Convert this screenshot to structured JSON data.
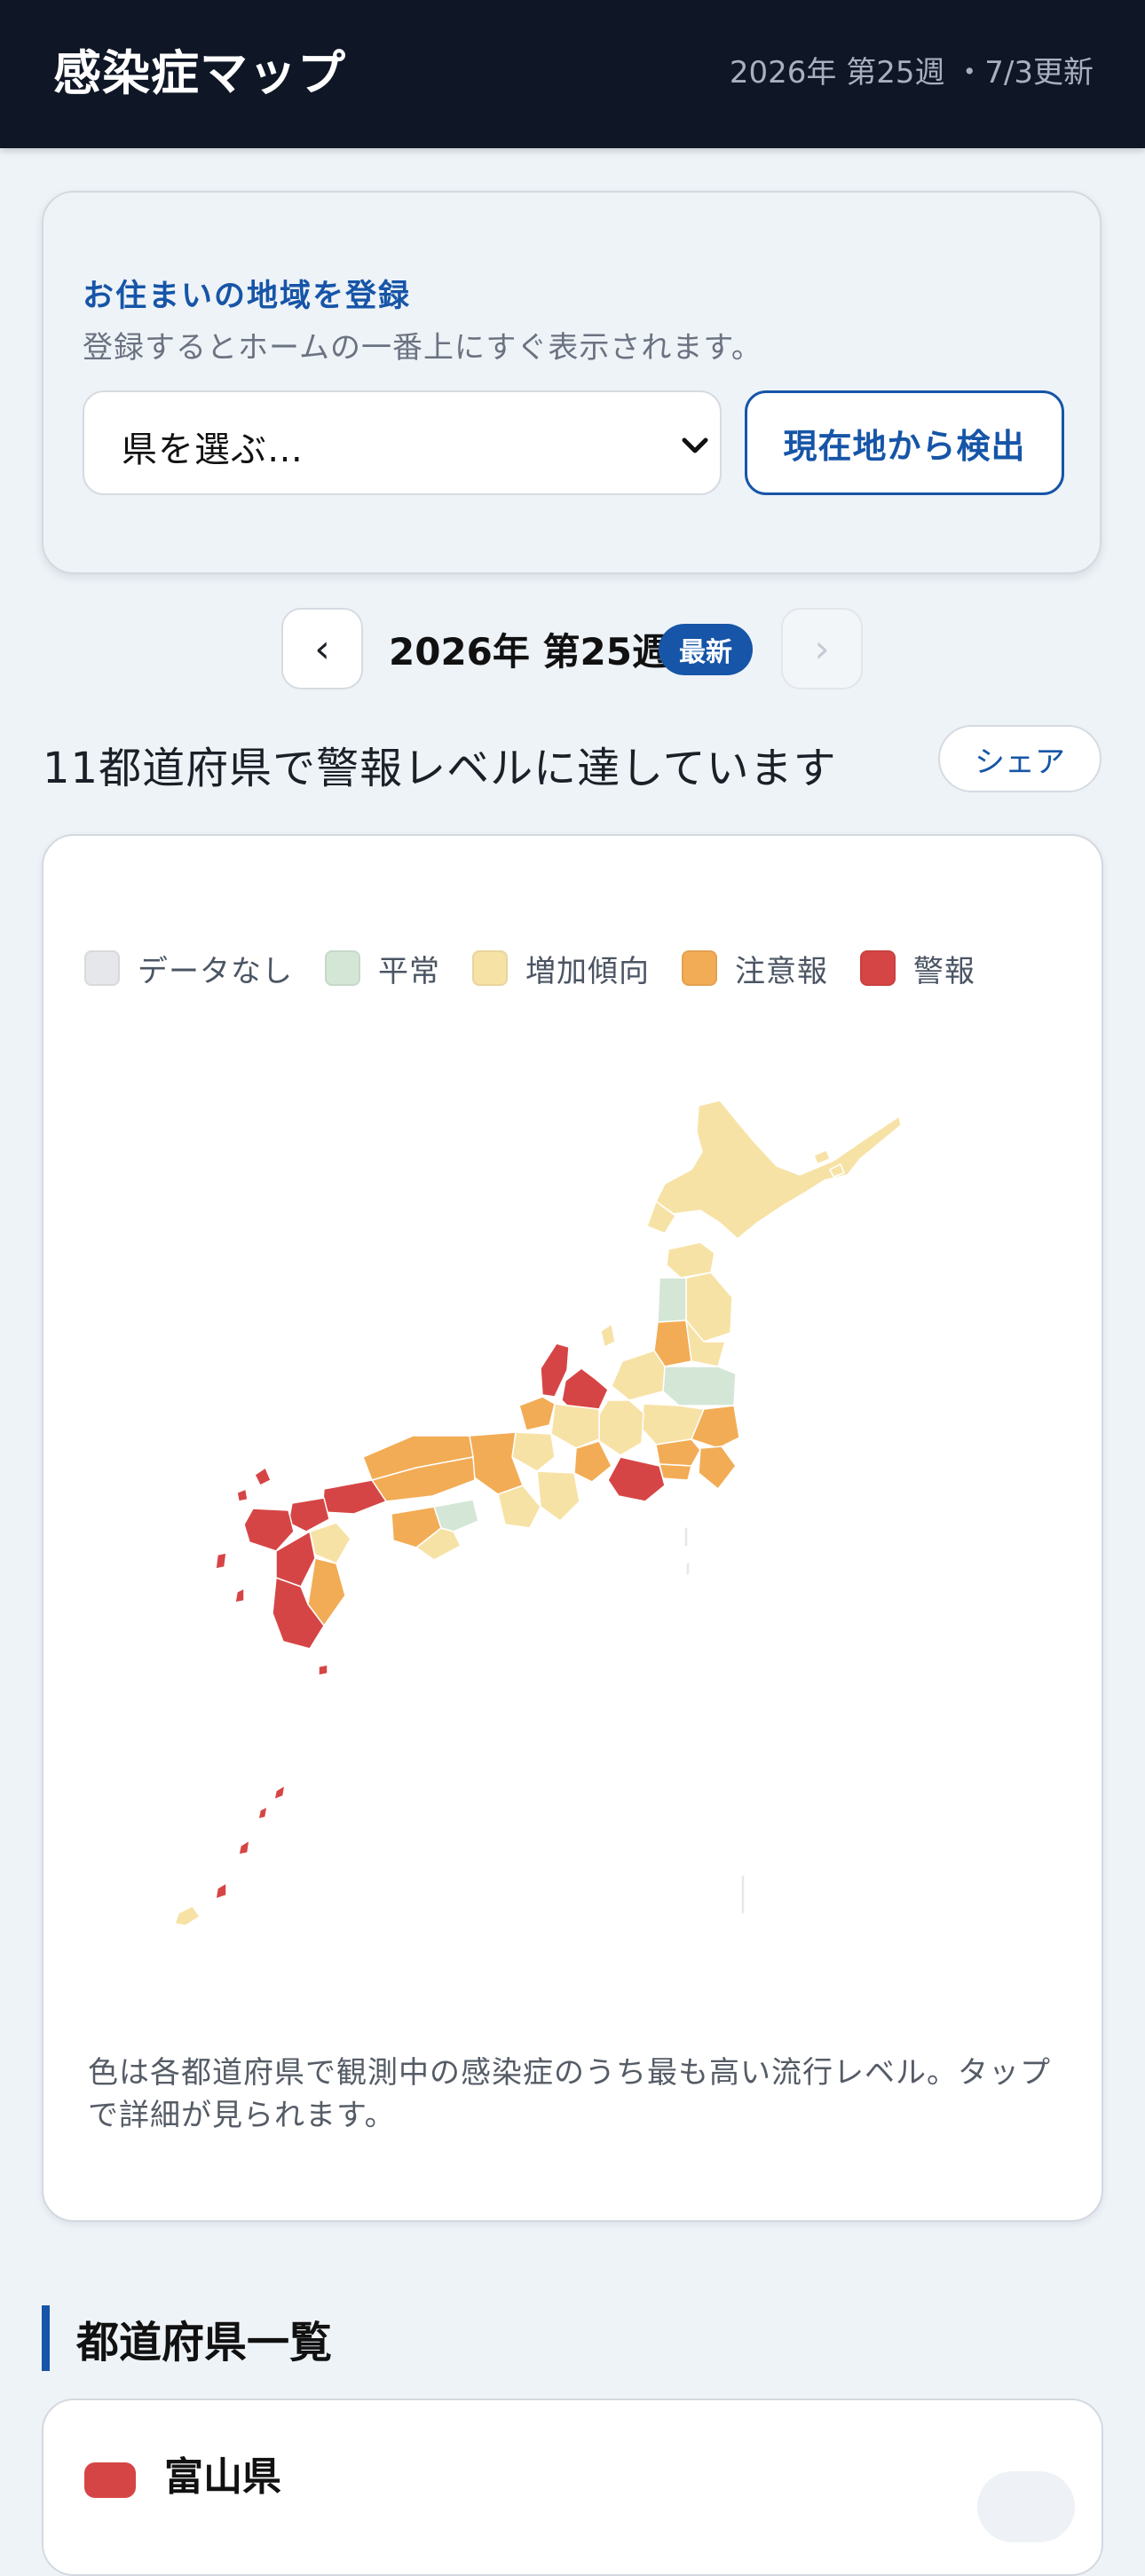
{
  "header": {
    "app_title": "感染症マップ",
    "updated": "2026年 第25週 ・7/3更新"
  },
  "register": {
    "title": "お住まいの地域を登録",
    "description": "登録するとホームの一番上にすぐ表示されます。",
    "select_placeholder": "県を選ぶ…",
    "detect_button": "現在地から検出"
  },
  "week_nav": {
    "prev_label": "‹",
    "next_label": "›",
    "week_label": "2026年 第25週",
    "latest_badge": "最新"
  },
  "summary": {
    "text": "11都道府県で警報レベルに達しています",
    "share_button": "シェア"
  },
  "legend": [
    {
      "label": "データなし",
      "color": "#e6e7ea"
    },
    {
      "label": "平常",
      "color": "#d4e6d6"
    },
    {
      "label": "増加傾向",
      "color": "#f7e2a6"
    },
    {
      "label": "注意報",
      "color": "#f2ac55"
    },
    {
      "label": "警報",
      "color": "#d64545"
    }
  ],
  "map_note": "色は各都道府県で観測中の感染症のうち最も高い流行レベル。タップで詳細が見られます。",
  "list": {
    "heading": "都道府県一覧",
    "first_item": "富山県",
    "first_item_color": "#d64545"
  }
}
